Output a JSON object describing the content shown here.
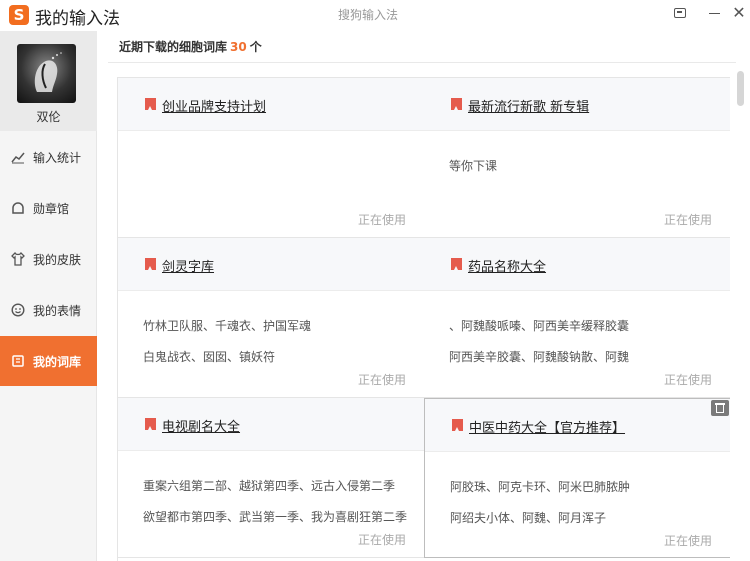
{
  "window": {
    "logo_char": "S",
    "title": "我的输入法",
    "subtitle": "搜狗输入法"
  },
  "sidebar": {
    "username": "双伦",
    "items": [
      {
        "label": "输入统计",
        "icon": "chart-icon",
        "active": false
      },
      {
        "label": "勋章馆",
        "icon": "medal-icon",
        "active": false
      },
      {
        "label": "我的皮肤",
        "icon": "shirt-icon",
        "active": false
      },
      {
        "label": "我的表情",
        "icon": "smiley-icon",
        "active": false
      },
      {
        "label": "我的词库",
        "icon": "book-icon",
        "active": true
      }
    ]
  },
  "main": {
    "header_prefix": "近期下载的细胞词库",
    "header_count": "30",
    "header_suffix": "个",
    "cards": [
      {
        "title": "创业品牌支持计划",
        "line1": "",
        "line2": "",
        "status": "正在使用"
      },
      {
        "title": "最新流行新歌 新专辑",
        "line1": "等你下课",
        "line2": "",
        "status": "正在使用"
      },
      {
        "title": "剑灵字库",
        "line1": "竹林卫队服、千魂衣、护国军魂",
        "line2": "白鬼战衣、囡囡、镇妖符",
        "status": "正在使用"
      },
      {
        "title": "药品名称大全",
        "line1": "、阿魏酸哌嗪、阿西美辛缓释胶囊",
        "line2": "阿西美辛胶囊、阿魏酸钠散、阿魏",
        "status": "正在使用"
      },
      {
        "title": "电视剧名大全",
        "line1": "重案六组第二部、越狱第四季、远古入侵第二季",
        "line2": "欲望都市第四季、武当第一季、我为喜剧狂第二季",
        "status": "正在使用"
      },
      {
        "title": "中医中药大全【官方推荐】",
        "line1": "阿胶珠、阿克卡环、阿米巴肺脓肿",
        "line2": "阿绍夫小体、阿魏、阿月浑子",
        "status": "正在使用"
      }
    ]
  },
  "colors": {
    "accent": "#f07030",
    "flag": "#e55b4d"
  }
}
